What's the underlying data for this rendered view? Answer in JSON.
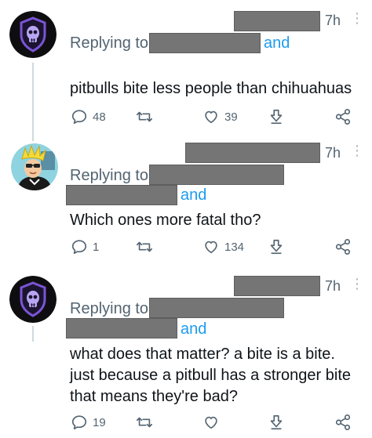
{
  "tweets": [
    {
      "time": "7h",
      "replying_label": "Replying to",
      "and_label": "and",
      "text_lines": [
        "pitbulls bite less people than chihuahuas"
      ],
      "counts": {
        "replies": "48",
        "retweets": "",
        "likes": "39"
      }
    },
    {
      "time": "7h",
      "replying_label": "Replying to",
      "and_label": "and",
      "text_lines": [
        "Which ones more fatal tho?"
      ],
      "counts": {
        "replies": "1",
        "retweets": "",
        "likes": "134"
      }
    },
    {
      "time": "7h",
      "replying_label": "Replying to",
      "and_label": "and",
      "text_lines": [
        "what does that matter?  a bite is a bite.",
        "just because a pitbull has a stronger bite",
        "that means they're bad?"
      ],
      "counts": {
        "replies": "19",
        "retweets": "",
        "likes": ""
      }
    }
  ],
  "colors": {
    "link": "#1d9bf0",
    "muted": "#536471",
    "redaction": "#757575"
  },
  "icons": [
    "skull-shield-avatar",
    "cartoon-avatar",
    "reply-icon",
    "retweet-icon",
    "like-icon",
    "download-icon",
    "share-icon",
    "more-icon"
  ]
}
